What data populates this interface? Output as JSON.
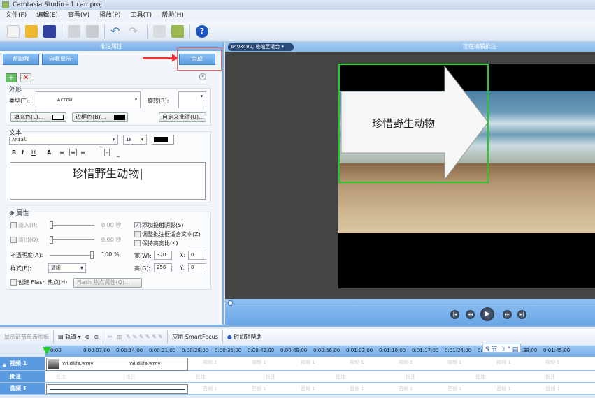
{
  "window": {
    "title": "Camtasia Studio - 1.camproj"
  },
  "menu": [
    "文件(F)",
    "编辑(E)",
    "查看(V)",
    "播放(P)",
    "工具(T)",
    "帮助(H)"
  ],
  "toolbar": {
    "icons": [
      "new-file-icon",
      "open-folder-icon",
      "save-icon",
      "export-icon",
      "save-disabled-icon",
      "undo-icon",
      "redo-icon",
      "list-icon",
      "produce-icon",
      "help-icon"
    ]
  },
  "left_panel": {
    "title": "批注属性",
    "help_button": "帮助我",
    "show_me_button": "向我显示",
    "done_button": "完成",
    "shape": {
      "label": "外形",
      "type_label": "类型(T):",
      "type_value": "Arrow",
      "rotate_label": "旋转(R):",
      "fill_button": "填充色(L)...",
      "fill_color": "#ffffff",
      "border_button": "边框色(B)...",
      "border_color": "#000000",
      "custom_button": "自定义批注(U)..."
    },
    "text": {
      "label": "文本",
      "font": "Arial",
      "size": "18",
      "color": "#000000",
      "format_buttons": [
        "B",
        "I",
        "U",
        "A"
      ],
      "content": "珍惜野生动物"
    },
    "props": {
      "label": "属性",
      "fade_in": "淡入(I):",
      "fade_in_value": "0.00 秒",
      "fade_out": "淡出(O):",
      "fade_out_value": "0.00 秒",
      "opacity_label": "不透明度(A):",
      "opacity_value": "100 %",
      "opacity": 100,
      "style_label": "样式(E):",
      "style_value": "清晰",
      "shadow": "添加投射阴影(S)",
      "shadow_checked": true,
      "fit_text": "调整批注框适合文本(Z)",
      "fit_text_checked": false,
      "keep_ratio": "保持高宽比(K)",
      "keep_ratio_checked": false,
      "width_label": "宽(W):",
      "width_value": "320",
      "height_label": "高(G):",
      "height_value": "256",
      "x_label": "X:",
      "x_value": "0",
      "y_label": "Y:",
      "y_value": "0",
      "flash_label": "创建 Flash 热点(H)",
      "flash_button": "Flash 热点属性(Q)..."
    }
  },
  "preview": {
    "zoom_select": "640x480, 收缩至适合",
    "status": "正在编辑批注",
    "callout_text": "珍惜野生动物",
    "progress": 0
  },
  "timeline": {
    "toolbar": [
      "显示箭节单击图板",
      "轨道",
      "应用 SmartFocus",
      "时间轴帮助"
    ],
    "ticks": [
      "0:00",
      "0:00:07;00",
      "0:00:14;00",
      "0:00:21;00",
      "0:00:28;00",
      "0:00:35;00",
      "0:00:42;00",
      "0:00:49;00",
      "0:00:56;00",
      "0:01:03;00",
      "0:01:10;00",
      "0:01:17;00",
      "0:01:24;00",
      "0:01:31;00",
      "0:01:38;00",
      "0:01:45;00"
    ],
    "ime": [
      "五"
    ],
    "tracks": [
      {
        "name": "视频 1",
        "clip": "Wildlife.wmv",
        "clip2": "Wildlife.wmv",
        "ghost": "视频 1"
      },
      {
        "name": "批注",
        "ghost": "批注"
      },
      {
        "name": "音频 1",
        "ghost": "音频 1"
      }
    ]
  }
}
